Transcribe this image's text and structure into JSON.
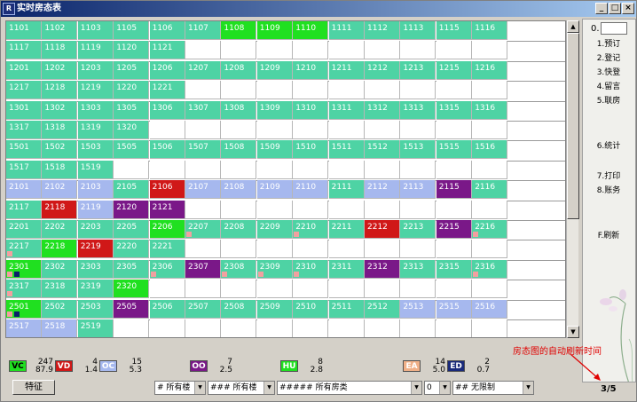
{
  "window": {
    "title": "实时房态表",
    "logo": "R",
    "minimize": "_",
    "maximize": "□",
    "close": "×"
  },
  "colors": {
    "vacant": "#4ed3a4",
    "dirty": "#d01818",
    "occupied": "#a6b8ee",
    "ooo": "#7a1888",
    "house_use": "#20e020",
    "expected": "#f0b088",
    "empty": "#ffffff"
  },
  "rows": [
    {
      "rooms": [
        {
          "no": "1101",
          "s": "vacant"
        },
        {
          "no": "1102",
          "s": "vacant"
        },
        {
          "no": "1103",
          "s": "vacant"
        },
        {
          "no": "1105",
          "s": "vacant"
        },
        {
          "no": "1106",
          "s": "vacant"
        },
        {
          "no": "1107",
          "s": "vacant"
        },
        {
          "no": "1108",
          "s": "house_use"
        },
        {
          "no": "1109",
          "s": "house_use"
        },
        {
          "no": "1110",
          "s": "house_use"
        },
        {
          "no": "1111",
          "s": "vacant"
        },
        {
          "no": "1112",
          "s": "vacant"
        },
        {
          "no": "1113",
          "s": "vacant"
        },
        {
          "no": "1115",
          "s": "vacant"
        },
        {
          "no": "1116",
          "s": "vacant"
        }
      ]
    },
    {
      "rooms": [
        {
          "no": "1117",
          "s": "vacant"
        },
        {
          "no": "1118",
          "s": "vacant"
        },
        {
          "no": "1119",
          "s": "vacant"
        },
        {
          "no": "1120",
          "s": "vacant"
        },
        {
          "no": "1121",
          "s": "vacant"
        }
      ]
    },
    {
      "rooms": [
        {
          "no": "1201",
          "s": "vacant"
        },
        {
          "no": "1202",
          "s": "vacant"
        },
        {
          "no": "1203",
          "s": "vacant"
        },
        {
          "no": "1205",
          "s": "vacant"
        },
        {
          "no": "1206",
          "s": "vacant"
        },
        {
          "no": "1207",
          "s": "vacant"
        },
        {
          "no": "1208",
          "s": "vacant"
        },
        {
          "no": "1209",
          "s": "vacant"
        },
        {
          "no": "1210",
          "s": "vacant"
        },
        {
          "no": "1211",
          "s": "vacant"
        },
        {
          "no": "1212",
          "s": "vacant"
        },
        {
          "no": "1213",
          "s": "vacant"
        },
        {
          "no": "1215",
          "s": "vacant"
        },
        {
          "no": "1216",
          "s": "vacant"
        }
      ]
    },
    {
      "rooms": [
        {
          "no": "1217",
          "s": "vacant"
        },
        {
          "no": "1218",
          "s": "vacant"
        },
        {
          "no": "1219",
          "s": "vacant"
        },
        {
          "no": "1220",
          "s": "vacant"
        },
        {
          "no": "1221",
          "s": "vacant"
        }
      ]
    },
    {
      "rooms": [
        {
          "no": "1301",
          "s": "vacant"
        },
        {
          "no": "1302",
          "s": "vacant"
        },
        {
          "no": "1303",
          "s": "vacant"
        },
        {
          "no": "1305",
          "s": "vacant"
        },
        {
          "no": "1306",
          "s": "vacant"
        },
        {
          "no": "1307",
          "s": "vacant"
        },
        {
          "no": "1308",
          "s": "vacant"
        },
        {
          "no": "1309",
          "s": "vacant"
        },
        {
          "no": "1310",
          "s": "vacant"
        },
        {
          "no": "1311",
          "s": "vacant"
        },
        {
          "no": "1312",
          "s": "vacant"
        },
        {
          "no": "1313",
          "s": "vacant"
        },
        {
          "no": "1315",
          "s": "vacant"
        },
        {
          "no": "1316",
          "s": "vacant"
        }
      ]
    },
    {
      "rooms": [
        {
          "no": "1317",
          "s": "vacant"
        },
        {
          "no": "1318",
          "s": "vacant"
        },
        {
          "no": "1319",
          "s": "vacant"
        },
        {
          "no": "1320",
          "s": "vacant"
        }
      ]
    },
    {
      "rooms": [
        {
          "no": "1501",
          "s": "vacant"
        },
        {
          "no": "1502",
          "s": "vacant"
        },
        {
          "no": "1503",
          "s": "vacant"
        },
        {
          "no": "1505",
          "s": "vacant"
        },
        {
          "no": "1506",
          "s": "vacant"
        },
        {
          "no": "1507",
          "s": "vacant"
        },
        {
          "no": "1508",
          "s": "vacant"
        },
        {
          "no": "1509",
          "s": "vacant"
        },
        {
          "no": "1510",
          "s": "vacant"
        },
        {
          "no": "1511",
          "s": "vacant"
        },
        {
          "no": "1512",
          "s": "vacant"
        },
        {
          "no": "1513",
          "s": "vacant"
        },
        {
          "no": "1515",
          "s": "vacant"
        },
        {
          "no": "1516",
          "s": "vacant"
        }
      ]
    },
    {
      "rooms": [
        {
          "no": "1517",
          "s": "vacant"
        },
        {
          "no": "1518",
          "s": "vacant"
        },
        {
          "no": "1519",
          "s": "vacant"
        }
      ]
    },
    {
      "rooms": [
        {
          "no": "2101",
          "s": "occupied"
        },
        {
          "no": "2102",
          "s": "occupied"
        },
        {
          "no": "2103",
          "s": "occupied"
        },
        {
          "no": "2105",
          "s": "vacant"
        },
        {
          "no": "2106",
          "s": "dirty"
        },
        {
          "no": "2107",
          "s": "occupied"
        },
        {
          "no": "2108",
          "s": "occupied"
        },
        {
          "no": "2109",
          "s": "occupied"
        },
        {
          "no": "2110",
          "s": "occupied"
        },
        {
          "no": "2111",
          "s": "vacant"
        },
        {
          "no": "2112",
          "s": "occupied"
        },
        {
          "no": "2113",
          "s": "occupied"
        },
        {
          "no": "2115",
          "s": "ooo"
        },
        {
          "no": "2116",
          "s": "vacant"
        }
      ]
    },
    {
      "rooms": [
        {
          "no": "2117",
          "s": "vacant"
        },
        {
          "no": "2118",
          "s": "dirty"
        },
        {
          "no": "2119",
          "s": "occupied"
        },
        {
          "no": "2120",
          "s": "ooo"
        },
        {
          "no": "2121",
          "s": "ooo"
        }
      ]
    },
    {
      "rooms": [
        {
          "no": "2201",
          "s": "vacant"
        },
        {
          "no": "2202",
          "s": "vacant"
        },
        {
          "no": "2203",
          "s": "vacant"
        },
        {
          "no": "2205",
          "s": "vacant"
        },
        {
          "no": "2206",
          "s": "house_use"
        },
        {
          "no": "2207",
          "s": "vacant",
          "m": 1
        },
        {
          "no": "2208",
          "s": "vacant"
        },
        {
          "no": "2209",
          "s": "vacant"
        },
        {
          "no": "2210",
          "s": "vacant",
          "m": 1
        },
        {
          "no": "2211",
          "s": "vacant"
        },
        {
          "no": "2212",
          "s": "dirty"
        },
        {
          "no": "2213",
          "s": "vacant"
        },
        {
          "no": "2215",
          "s": "ooo"
        },
        {
          "no": "2216",
          "s": "vacant",
          "m": 1
        }
      ]
    },
    {
      "rooms": [
        {
          "no": "2217",
          "s": "vacant",
          "m": 1
        },
        {
          "no": "2218",
          "s": "house_use"
        },
        {
          "no": "2219",
          "s": "dirty"
        },
        {
          "no": "2220",
          "s": "vacant"
        },
        {
          "no": "2221",
          "s": "vacant"
        }
      ]
    },
    {
      "rooms": [
        {
          "no": "2301",
          "s": "house_use",
          "m": 1,
          "n": 1
        },
        {
          "no": "2302",
          "s": "vacant"
        },
        {
          "no": "2303",
          "s": "vacant"
        },
        {
          "no": "2305",
          "s": "vacant"
        },
        {
          "no": "2306",
          "s": "vacant",
          "m": 1
        },
        {
          "no": "2307",
          "s": "ooo"
        },
        {
          "no": "2308",
          "s": "vacant",
          "m": 1
        },
        {
          "no": "2309",
          "s": "vacant",
          "m": 1
        },
        {
          "no": "2310",
          "s": "vacant",
          "m": 1
        },
        {
          "no": "2311",
          "s": "vacant"
        },
        {
          "no": "2312",
          "s": "ooo"
        },
        {
          "no": "2313",
          "s": "vacant"
        },
        {
          "no": "2315",
          "s": "vacant"
        },
        {
          "no": "2316",
          "s": "vacant",
          "m": 1
        }
      ]
    },
    {
      "rooms": [
        {
          "no": "2317",
          "s": "vacant",
          "m": 1
        },
        {
          "no": "2318",
          "s": "vacant"
        },
        {
          "no": "2319",
          "s": "vacant"
        },
        {
          "no": "2320",
          "s": "house_use"
        }
      ]
    },
    {
      "rooms": [
        {
          "no": "2501",
          "s": "house_use",
          "m": 1,
          "n": 1
        },
        {
          "no": "2502",
          "s": "vacant"
        },
        {
          "no": "2503",
          "s": "vacant"
        },
        {
          "no": "2505",
          "s": "ooo"
        },
        {
          "no": "2506",
          "s": "vacant"
        },
        {
          "no": "2507",
          "s": "vacant"
        },
        {
          "no": "2508",
          "s": "vacant"
        },
        {
          "no": "2509",
          "s": "vacant"
        },
        {
          "no": "2510",
          "s": "vacant"
        },
        {
          "no": "2511",
          "s": "vacant"
        },
        {
          "no": "2512",
          "s": "vacant"
        },
        {
          "no": "2513",
          "s": "occupied"
        },
        {
          "no": "2515",
          "s": "occupied"
        },
        {
          "no": "2516",
          "s": "occupied"
        }
      ]
    },
    {
      "rooms": [
        {
          "no": "2517",
          "s": "occupied"
        },
        {
          "no": "2518",
          "s": "occupied"
        },
        {
          "no": "2519",
          "s": "vacant"
        }
      ]
    }
  ],
  "side": {
    "input_label": "0.",
    "input_value": "",
    "items": [
      "1.预订",
      "2.登记",
      "3.快登",
      "4.留言",
      "5.联房",
      "6.统计",
      "7.打印",
      "8.账务",
      "F.刷新"
    ]
  },
  "legend": [
    {
      "code": "VC",
      "color": "#20e020",
      "fg": "#000",
      "top": "247",
      "bottom": "87.9"
    },
    {
      "code": "VD",
      "color": "#d01818",
      "fg": "#fff",
      "top": "4",
      "bottom": "1.4"
    },
    {
      "code": "OC",
      "color": "#a6b8ee",
      "fg": "#fff",
      "top": "15",
      "bottom": "5.3"
    },
    {
      "code": "OO",
      "color": "#7a1888",
      "fg": "#fff",
      "top": "7",
      "bottom": "2.5"
    },
    {
      "code": "HU",
      "color": "#20e020",
      "fg": "#fff",
      "top": "8",
      "bottom": "2.8"
    },
    {
      "code": "EA",
      "color": "#f0b088",
      "fg": "#fff",
      "top": "14",
      "bottom": "5.0"
    },
    {
      "code": "ED",
      "color": "#1a2a7a",
      "fg": "#fff",
      "top": "2",
      "bottom": "0.7"
    }
  ],
  "toolbar": {
    "special_button": "特征",
    "combos": [
      "# 所有楼",
      "### 所有楼",
      "##### 所有房类",
      "0",
      "## 无限制"
    ]
  },
  "annotation": "房态图的自动刷新时间",
  "page_indicator": "3/5"
}
